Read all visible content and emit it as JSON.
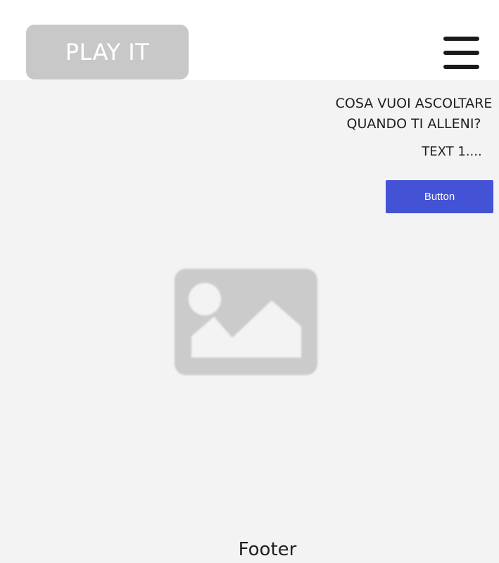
{
  "header": {
    "logo_text": "PLAY IT",
    "menu_icon": "hamburger-menu-icon"
  },
  "main": {
    "headline_line1": "COSA VUOI ASCOLTARE",
    "headline_line2": "QUANDO TI ALLENI?",
    "subtext": "TEXT 1....",
    "button_label": "Button",
    "button_color": "#4452d6",
    "image_icon": "image-placeholder-icon"
  },
  "footer": {
    "label": "Footer"
  }
}
